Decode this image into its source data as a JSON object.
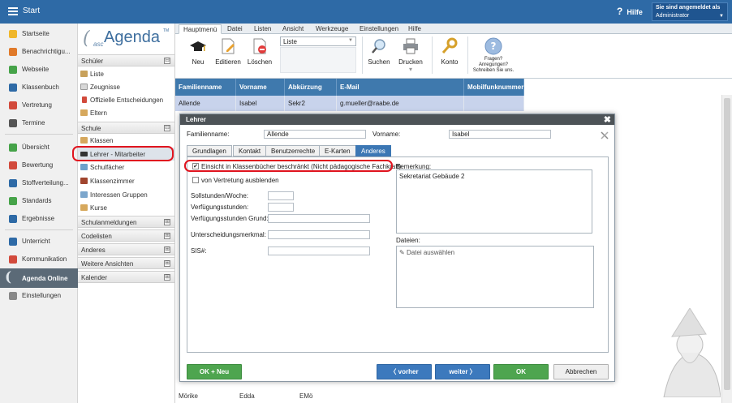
{
  "topbar": {
    "title": "Start",
    "help": "Hilfe",
    "login_line": "Sie sind angemeldet als",
    "user": "Administrator"
  },
  "leftnav": [
    {
      "label": "Startseite",
      "color": "#f0b72b"
    },
    {
      "label": "Benachrichtigu...",
      "color": "#e07a2a"
    },
    {
      "label": "Webseite",
      "color": "#46a349"
    },
    {
      "label": "Klassenbuch",
      "color": "#2e6aa6"
    },
    {
      "label": "Vertretung",
      "color": "#d24a3c"
    },
    {
      "label": "Termine",
      "color": "#555555"
    },
    {
      "label": "Übersicht",
      "color": "#46a349"
    },
    {
      "label": "Bewertung",
      "color": "#d24a3c"
    },
    {
      "label": "Stoffverteilung...",
      "color": "#2e6aa6"
    },
    {
      "label": "Standards",
      "color": "#46a349"
    },
    {
      "label": "Ergebnisse",
      "color": "#2e6aa6"
    },
    {
      "label": "Unterricht",
      "color": "#2e6aa6"
    },
    {
      "label": "Kommunikation",
      "color": "#d24a3c"
    },
    {
      "label": "Agenda Online",
      "color": "#5b6a77"
    },
    {
      "label": "Einstellungen",
      "color": "#888888"
    }
  ],
  "logo": {
    "prefix": "asc",
    "name": "Agenda",
    "tm": "TM"
  },
  "sidebar": {
    "schueler": {
      "header": "Schüler",
      "toggle": "⊟",
      "items": [
        "Liste",
        "Zeugnisse",
        "Offizielle Entscheidungen",
        "Eltern"
      ]
    },
    "schule": {
      "header": "Schule",
      "toggle": "⊟",
      "items": [
        "Klassen",
        "Lehrer - Mitarbeiter",
        "Schulfächer",
        "Klassenzimmer",
        "Interessen Gruppen",
        "Kurse"
      ]
    },
    "collapsed": [
      "Schulanmeldungen",
      "Codelisten",
      "Anderes",
      "Weitere Ansichten",
      "Kalender"
    ],
    "plus": "⊞"
  },
  "ribbon": {
    "tabs": [
      "Hauptmenü",
      "Datei",
      "Listen",
      "Ansicht",
      "Werkzeuge",
      "Einstellungen",
      "Hilfe"
    ],
    "new": "Neu",
    "edit": "Editieren",
    "delete": "Löschen",
    "view": "Liste",
    "search": "Suchen",
    "print": "Drucken",
    "account": "Konto",
    "help_line1": "Fragen?",
    "help_line2": "Anregungen?",
    "help_line3": "Schreiben Sie uns."
  },
  "grid": {
    "columns": [
      "Familienname",
      "Vorname",
      "Abkürzung",
      "E-Mail",
      "Mobilfunknummer"
    ],
    "row": [
      "Allende",
      "Isabel",
      "Sekr2",
      "g.mueller@raabe.de",
      ""
    ],
    "bottom_row": [
      "Mörike",
      "Edda",
      "EMö"
    ]
  },
  "dialog": {
    "title": "Lehrer",
    "close": "✖",
    "lastname_label": "Familienname:",
    "lastname": "Allende",
    "firstname_label": "Vorname:",
    "firstname": "Isabel",
    "tabs": [
      "Grundlagen",
      "Kontakt",
      "Benutzerrechte",
      "E-Karten",
      "Anderes"
    ],
    "chk1": "Einsicht in Klassenbücher beschränkt (Nicht pädagogische Fachkraft)",
    "chk2": "von Vertretung ausblenden",
    "f1": "Sollstunden/Woche:",
    "f2": "Verfügungsstunden:",
    "f3": "Verfügungsstunden Grund:",
    "f4": "Unterscheidungsmerkmal:",
    "f5": "SIS#:",
    "remark_label": "Bemerkung:",
    "remark": "Sekretariat Gebäude 2",
    "files_label": "Dateien:",
    "files_btn": "Datei auswählen",
    "btn_okneu": "OK + Neu",
    "btn_prev": "vorher",
    "btn_next": "weiter",
    "btn_ok": "OK",
    "btn_cancel": "Abbrechen"
  }
}
